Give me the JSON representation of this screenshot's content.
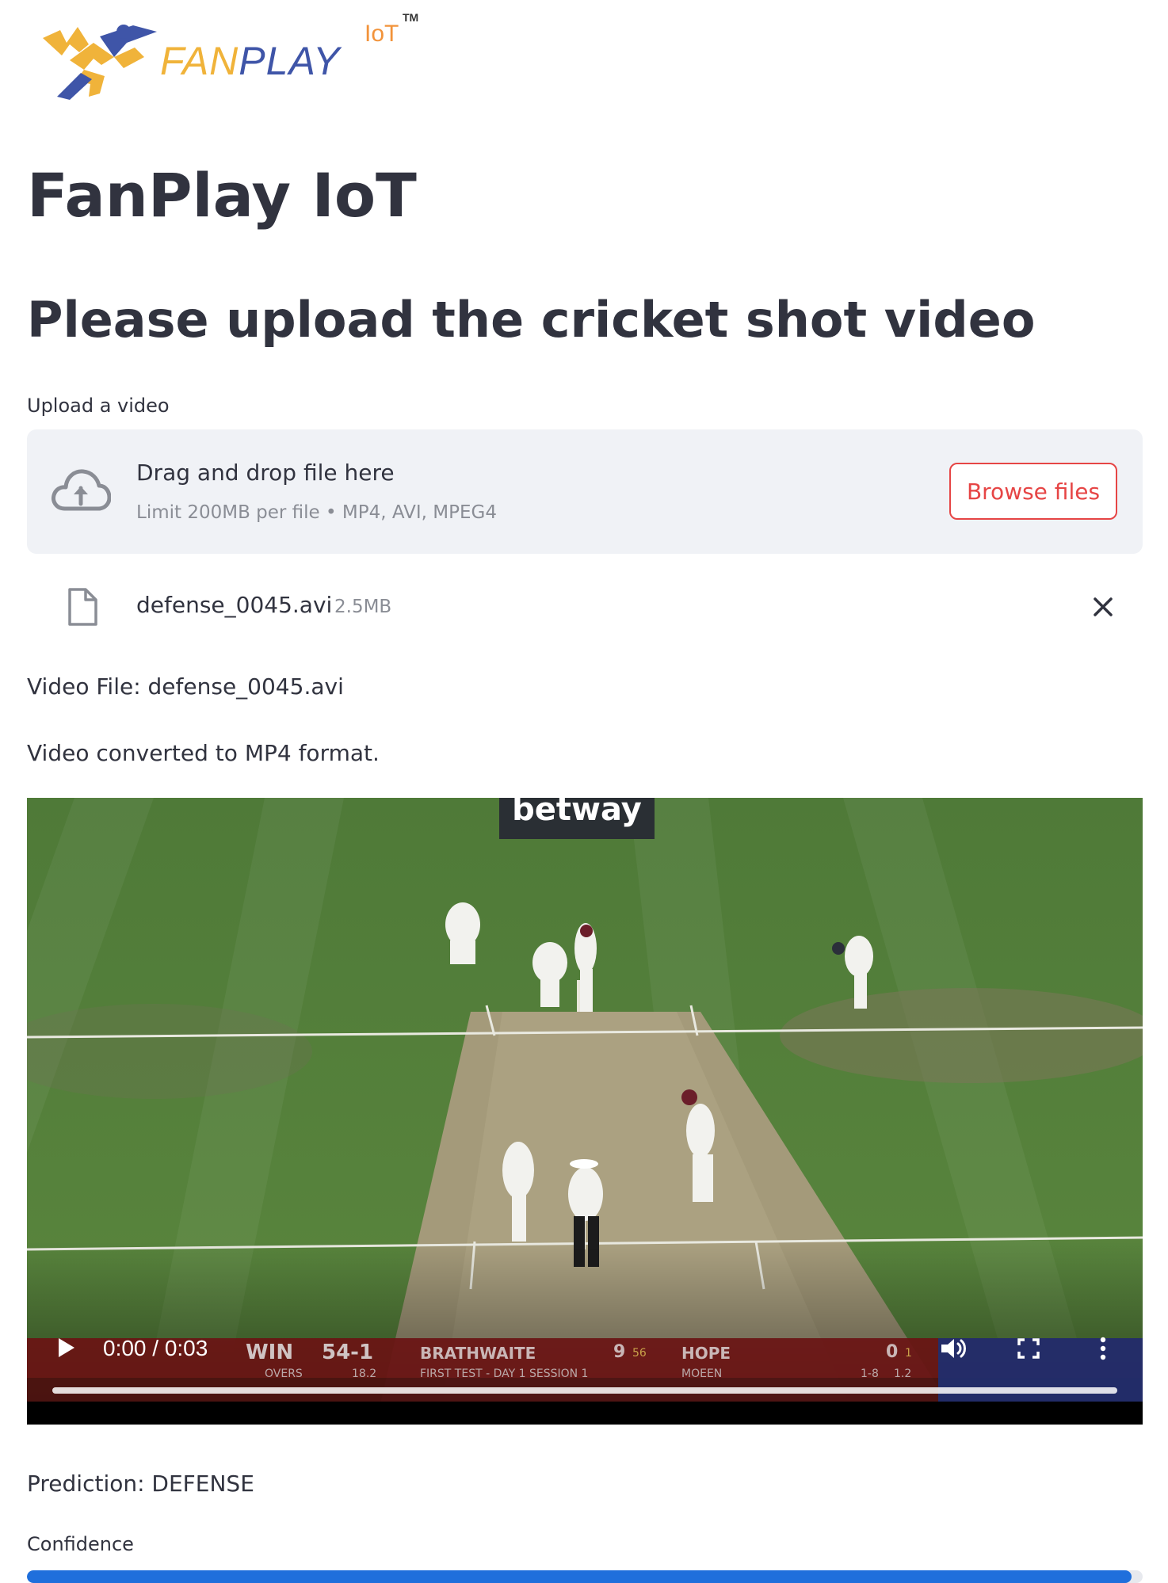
{
  "logo": {
    "word_fan": "FAN",
    "word_play": "PLAY",
    "iot": "IoT",
    "tm": "TM"
  },
  "title": "FanPlay IoT",
  "subtitle": "Please upload the cricket shot video",
  "uploader": {
    "label": "Upload a video",
    "drop_title": "Drag and drop file here",
    "limit_text": "Limit 200MB per file • MP4, AVI, MPEG4",
    "browse_label": "Browse files",
    "icon": "cloud-upload-icon"
  },
  "uploaded_file": {
    "name": "defense_0045.avi",
    "size": "2.5MB",
    "icon": "file-icon",
    "remove_icon": "close-icon"
  },
  "video_file_text": "Video File: defense_0045.avi",
  "converted_text": "Video converted to MP4 format.",
  "video": {
    "time": "0:00 / 0:03",
    "progress_fraction": 0,
    "banner": "betway",
    "scorebar": {
      "team": "WIN",
      "score": "54-1",
      "overs_label": "OVERS",
      "overs": "18.2",
      "batter1": "BRATHWAITE",
      "batter1_runs": "9",
      "batter1_balls": "56",
      "batter2": "HOPE",
      "batter2_runs": "0",
      "batter2_balls": "1",
      "match": "FIRST TEST - DAY 1 SESSION 1",
      "bowler": "MOEEN",
      "bowler_figures": "1-8",
      "bowler_overs": "1.2"
    }
  },
  "prediction_text": "Prediction: DEFENSE",
  "confidence": {
    "label": "Confidence",
    "value_fraction": 0.99
  },
  "colors": {
    "accent": "#e64545",
    "progress": "#1f6fdc",
    "text": "#31333f",
    "muted": "#8a8d95",
    "surface": "#f0f2f6"
  }
}
